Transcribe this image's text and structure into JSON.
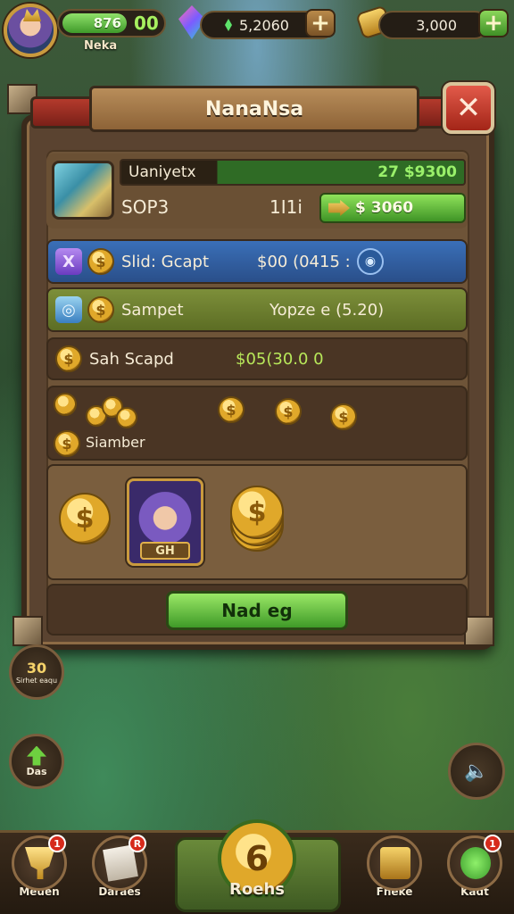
{
  "hud": {
    "xp_value": "876",
    "level": "00",
    "player_name": "Neka",
    "gems": "5,2060",
    "gold": "3,000"
  },
  "dialog": {
    "title": "NanaNsa",
    "close_icon": "close-icon",
    "hero": {
      "name": "Uaniyetx",
      "gold_value": "27 $9300",
      "code": "SOP3",
      "stat": "1I1i",
      "price_label": "$ 3060"
    },
    "items": [
      {
        "label": "Slid: Gcapt",
        "value": "$00 (0415 :",
        "tag": "X"
      },
      {
        "label": "Sampet",
        "value": "Yopze e (5.20)",
        "tag": "◎"
      },
      {
        "label": "Sah Scapd",
        "value": "$05(30.0 0"
      }
    ],
    "coins_row": {
      "label": "Siamber"
    },
    "reward_card_label": "GH",
    "action_button": "Nad eg"
  },
  "side": {
    "timer_big": "30",
    "timer_small": "Sirhet eaqu",
    "up_label": "Das"
  },
  "bottom_nav": {
    "items": [
      {
        "label": "Meuen",
        "badge": "1"
      },
      {
        "label": "Daraes",
        "badge": "R"
      },
      {
        "label": "Fheke",
        "badge": ""
      },
      {
        "label": "Kadt",
        "badge": "1"
      }
    ],
    "center_label": "Roehs",
    "center_glyph": "6"
  },
  "colors": {
    "accent_green": "#3f9a28",
    "wood_brown": "#5a4330",
    "close_red": "#a32518",
    "gold": "#e0a82a"
  }
}
